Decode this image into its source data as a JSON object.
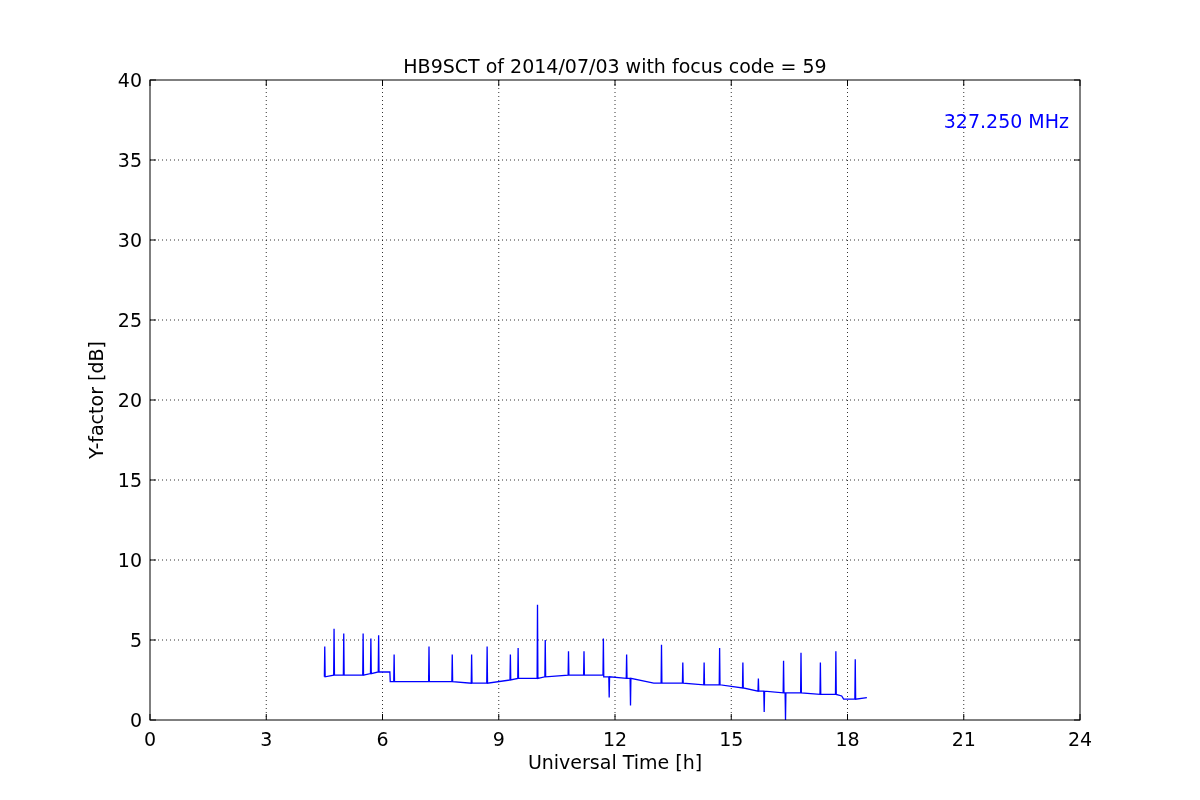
{
  "figure": {
    "chart_data": {
      "type": "line",
      "title": "HB9SCT of 2014/07/03 with focus code = 59",
      "xlabel": "Universal Time [h]",
      "ylabel": "Y-factor [dB]",
      "xlim": [
        0,
        24
      ],
      "ylim": [
        0,
        40
      ],
      "xticks": [
        0,
        3,
        6,
        9,
        12,
        15,
        18,
        21,
        24
      ],
      "yticks": [
        0,
        5,
        10,
        15,
        20,
        25,
        30,
        35,
        40
      ],
      "x": [
        4.5,
        4.51,
        4.52,
        4.74,
        4.75,
        4.76,
        4.99,
        5.0,
        5.01,
        5.49,
        5.5,
        5.51,
        5.69,
        5.7,
        5.71,
        5.89,
        5.9,
        5.91,
        6.19,
        6.2,
        6.29,
        6.3,
        6.31,
        7.19,
        7.2,
        7.21,
        7.79,
        7.8,
        7.81,
        8.29,
        8.3,
        8.31,
        8.69,
        8.7,
        8.71,
        9.29,
        9.3,
        9.31,
        9.49,
        9.5,
        9.51,
        9.99,
        10.0,
        10.01,
        10.19,
        10.2,
        10.21,
        10.79,
        10.8,
        10.81,
        11.19,
        11.2,
        11.21,
        11.69,
        11.7,
        11.71,
        11.84,
        11.85,
        11.86,
        12.29,
        12.3,
        12.31,
        12.39,
        12.4,
        12.41,
        13.0,
        13.19,
        13.2,
        13.21,
        13.74,
        13.75,
        13.76,
        14.29,
        14.3,
        14.31,
        14.69,
        14.7,
        14.71,
        15.29,
        15.3,
        15.31,
        15.69,
        15.7,
        15.71,
        15.84,
        15.85,
        15.86,
        16.34,
        16.35,
        16.36,
        16.39,
        16.4,
        16.41,
        16.79,
        16.8,
        16.81,
        17.29,
        17.3,
        17.31,
        17.69,
        17.7,
        17.71,
        17.85,
        17.9,
        18.19,
        18.2,
        18.21,
        18.5
      ],
      "series": [
        {
          "name": "327.250 MHz",
          "color": "#0000ff",
          "values": [
            2.7,
            4.6,
            2.7,
            2.8,
            5.7,
            2.8,
            2.8,
            5.4,
            2.8,
            2.8,
            5.4,
            2.8,
            2.9,
            5.1,
            2.9,
            3.0,
            5.3,
            3.0,
            3.0,
            2.4,
            2.4,
            4.1,
            2.4,
            2.4,
            4.6,
            2.4,
            2.4,
            4.1,
            2.4,
            2.3,
            4.1,
            2.3,
            2.3,
            4.6,
            2.3,
            2.5,
            4.1,
            2.5,
            2.6,
            4.5,
            2.6,
            2.6,
            7.2,
            2.6,
            2.7,
            5.0,
            2.7,
            2.8,
            4.3,
            2.8,
            2.8,
            4.3,
            2.8,
            2.8,
            5.1,
            2.7,
            2.7,
            1.4,
            2.7,
            2.6,
            4.1,
            2.6,
            2.6,
            0.9,
            2.6,
            2.3,
            2.3,
            4.7,
            2.3,
            2.3,
            3.6,
            2.3,
            2.2,
            3.6,
            2.2,
            2.2,
            4.5,
            2.2,
            2.0,
            3.6,
            2.0,
            1.8,
            2.6,
            1.8,
            1.8,
            0.5,
            1.8,
            1.7,
            3.7,
            1.7,
            1.7,
            0.0,
            1.7,
            1.7,
            4.2,
            1.7,
            1.6,
            3.6,
            1.6,
            1.6,
            4.3,
            1.6,
            1.5,
            1.3,
            1.3,
            3.8,
            1.3,
            1.4
          ]
        }
      ],
      "grid": true
    }
  }
}
